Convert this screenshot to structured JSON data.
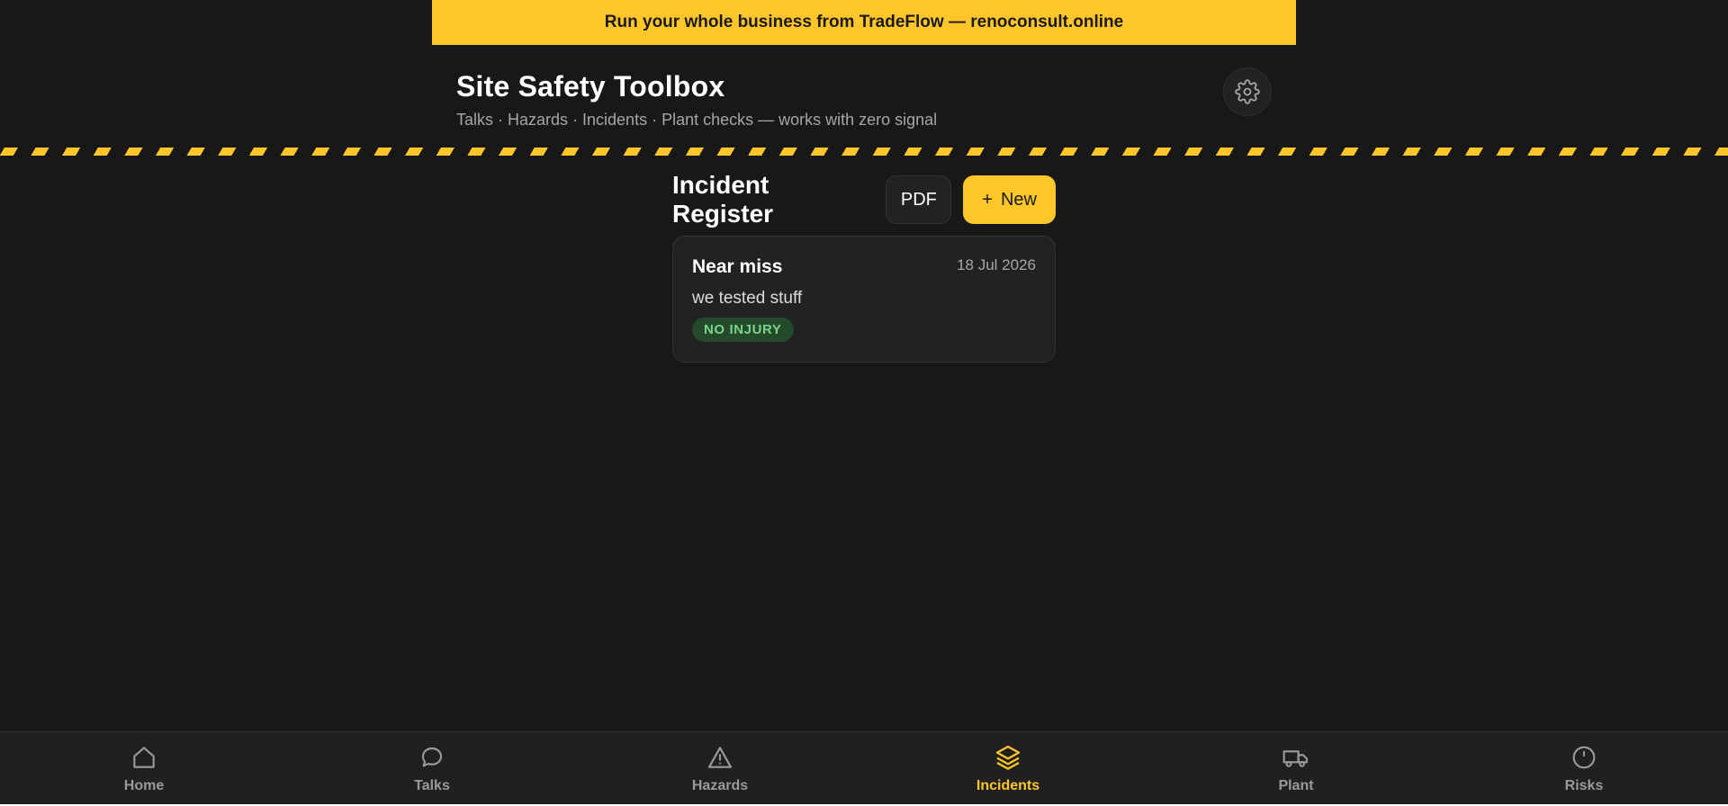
{
  "promo": {
    "text": "Run your whole business from TradeFlow — renoconsult.online"
  },
  "header": {
    "title": "Site Safety Toolbox",
    "subtitle": "Talks · Hazards · Incidents · Plant checks — works with zero signal",
    "settings_icon": "gear-icon"
  },
  "register": {
    "title": "Incident Register",
    "pdf_label": "PDF",
    "new_plus": "+",
    "new_label": "New"
  },
  "incidents": [
    {
      "type": "Near miss",
      "date": "18 Jul 2026",
      "description": "we tested stuff",
      "severity": "NO INJURY"
    }
  ],
  "nav": {
    "active": "Incidents",
    "items": [
      {
        "label": "Home",
        "icon": "home-icon"
      },
      {
        "label": "Talks",
        "icon": "chat-bubble-icon"
      },
      {
        "label": "Hazards",
        "icon": "warning-triangle-icon"
      },
      {
        "label": "Incidents",
        "icon": "layers-icon"
      },
      {
        "label": "Plant",
        "icon": "truck-icon"
      },
      {
        "label": "Risks",
        "icon": "alert-circle-icon"
      }
    ]
  },
  "colors": {
    "accent": "#ffc62b",
    "background": "#181818",
    "card": "#222222",
    "badge_bg": "#244a2b",
    "badge_text": "#7bd48a",
    "muted_text": "#a6a6a6"
  }
}
